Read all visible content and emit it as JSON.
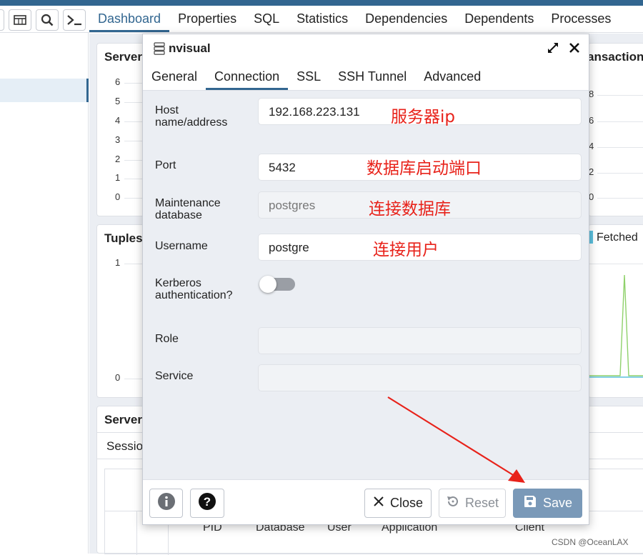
{
  "main_tabs": [
    "Dashboard",
    "Properties",
    "SQL",
    "Statistics",
    "Dependencies",
    "Dependents",
    "Processes"
  ],
  "toolbar": {
    "icons": [
      "table-icon",
      "search-icon",
      "terminal-icon"
    ]
  },
  "dashboard": {
    "server_sessions_title": "Server",
    "transactions_title": "ansaction",
    "tuples_title": "Tuples",
    "fetched_legend": "Fetched",
    "server_activity_title": "Server",
    "sessions_tab": "Sessio",
    "y_ticks_sessions": [
      "6",
      "5",
      "4",
      "3",
      "2",
      "1",
      "0"
    ],
    "y_ticks_tuples": [
      "1",
      "0"
    ],
    "y_ticks_right": [
      "8",
      "6",
      "4",
      "2",
      "0"
    ],
    "table_headers": [
      "PID",
      "Database",
      "User",
      "Application",
      "Client"
    ],
    "colors": {
      "primary": "#326690",
      "fetched": "#5bc0de",
      "line_green": "#8fd16b"
    }
  },
  "modal": {
    "title": "nvisual",
    "tabs": [
      "General",
      "Connection",
      "SSL",
      "SSH Tunnel",
      "Advanced"
    ],
    "active_tab": "Connection",
    "fields": [
      {
        "label": "Host name/address",
        "value": "192.168.223.131",
        "annotation": "服务器ip"
      },
      {
        "label": "Port",
        "value": "5432",
        "annotation": "数据库启动端口"
      },
      {
        "label": "Maintenance database",
        "value": "postgres",
        "annotation": "连接数据库"
      },
      {
        "label": "Username",
        "value": "postgre",
        "annotation": "连接用户"
      },
      {
        "label": "Kerberos authentication?",
        "toggle": false
      },
      {
        "label": "Role",
        "value": ""
      },
      {
        "label": "Service",
        "value": ""
      }
    ],
    "buttons": {
      "close": "Close",
      "reset": "Reset",
      "save": "Save"
    }
  },
  "watermark": "CSDN @OceanLAX"
}
